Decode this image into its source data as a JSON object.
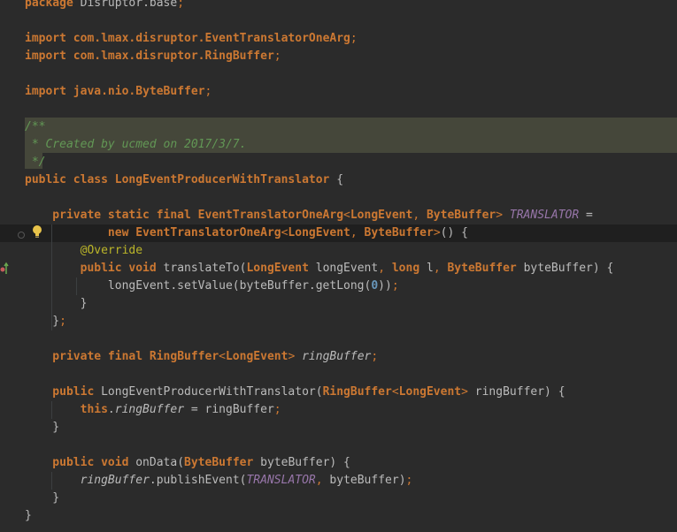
{
  "editor": {
    "lines": [
      {
        "tokens": [
          {
            "t": "package",
            "c": "kw"
          },
          {
            "t": " Disruptor.base",
            "c": "plain"
          },
          {
            "t": ";",
            "c": "punct"
          }
        ]
      },
      {
        "tokens": []
      },
      {
        "tokens": [
          {
            "t": "import",
            "c": "kw"
          },
          {
            "t": " com.lmax.disruptor.",
            "c": "type"
          },
          {
            "t": "EventTranslatorOneArg",
            "c": "type"
          },
          {
            "t": ";",
            "c": "punct"
          }
        ]
      },
      {
        "tokens": [
          {
            "t": "import",
            "c": "kw"
          },
          {
            "t": " com.lmax.disruptor.",
            "c": "type"
          },
          {
            "t": "RingBuffer",
            "c": "type"
          },
          {
            "t": ";",
            "c": "punct"
          }
        ]
      },
      {
        "tokens": []
      },
      {
        "tokens": [
          {
            "t": "import",
            "c": "kw"
          },
          {
            "t": " java.nio.",
            "c": "type"
          },
          {
            "t": "ByteBuffer",
            "c": "type"
          },
          {
            "t": ";",
            "c": "punct"
          }
        ]
      },
      {
        "tokens": []
      },
      {
        "tokens": [
          {
            "t": "/**",
            "c": "comment"
          }
        ]
      },
      {
        "tokens": [
          {
            "t": " * Created by ucmed on 2017/3/7.",
            "c": "comment"
          }
        ]
      },
      {
        "tokens": [
          {
            "t": " */",
            "c": "comment"
          }
        ]
      },
      {
        "tokens": [
          {
            "t": "public class",
            "c": "kw"
          },
          {
            "t": " LongEventProducerWithTranslator",
            "c": "type"
          },
          {
            "t": " {",
            "c": "plain"
          }
        ]
      },
      {
        "tokens": []
      },
      {
        "tokens": [
          {
            "t": "    private static final",
            "c": "kw"
          },
          {
            "t": " EventTranslatorOneArg",
            "c": "type"
          },
          {
            "t": "<",
            "c": "gen"
          },
          {
            "t": "LongEvent",
            "c": "type"
          },
          {
            "t": ", ",
            "c": "punct"
          },
          {
            "t": "ByteBuffer",
            "c": "type"
          },
          {
            "t": "> ",
            "c": "gen"
          },
          {
            "t": "TRANSLATOR",
            "c": "const"
          },
          {
            "t": " =",
            "c": "plain"
          }
        ]
      },
      {
        "tokens": [
          {
            "t": "            new",
            "c": "kw"
          },
          {
            "t": " EventTranslatorOneArg",
            "c": "type"
          },
          {
            "t": "<",
            "c": "gen"
          },
          {
            "t": "LongEvent",
            "c": "type"
          },
          {
            "t": ", ",
            "c": "punct"
          },
          {
            "t": "ByteBuffer",
            "c": "type"
          },
          {
            "t": ">",
            "c": "gen"
          },
          {
            "t": "() {",
            "c": "plain"
          }
        ]
      },
      {
        "tokens": [
          {
            "t": "        ",
            "c": "plain"
          },
          {
            "t": "@Override",
            "c": "ann"
          }
        ]
      },
      {
        "tokens": [
          {
            "t": "        public void",
            "c": "kw"
          },
          {
            "t": " translateTo(",
            "c": "plain"
          },
          {
            "t": "LongEvent",
            "c": "type"
          },
          {
            "t": " longEvent",
            "c": "plain"
          },
          {
            "t": ", ",
            "c": "punct"
          },
          {
            "t": "long",
            "c": "kw"
          },
          {
            "t": " l",
            "c": "plain"
          },
          {
            "t": ", ",
            "c": "punct"
          },
          {
            "t": "ByteBuffer",
            "c": "type"
          },
          {
            "t": " byteBuffer) {",
            "c": "plain"
          }
        ]
      },
      {
        "tokens": [
          {
            "t": "            longEvent.setValue(byteBuffer.getLong(",
            "c": "plain"
          },
          {
            "t": "0",
            "c": "num"
          },
          {
            "t": "))",
            "c": "plain"
          },
          {
            "t": ";",
            "c": "punct"
          }
        ]
      },
      {
        "tokens": [
          {
            "t": "        }",
            "c": "plain"
          }
        ]
      },
      {
        "tokens": [
          {
            "t": "    }",
            "c": "plain"
          },
          {
            "t": ";",
            "c": "punct"
          }
        ]
      },
      {
        "tokens": []
      },
      {
        "tokens": [
          {
            "t": "    private final",
            "c": "kw"
          },
          {
            "t": " RingBuffer",
            "c": "type"
          },
          {
            "t": "<",
            "c": "gen"
          },
          {
            "t": "LongEvent",
            "c": "type"
          },
          {
            "t": "> ",
            "c": "gen"
          },
          {
            "t": "ringBuffer",
            "c": "field"
          },
          {
            "t": ";",
            "c": "punct"
          }
        ]
      },
      {
        "tokens": []
      },
      {
        "tokens": [
          {
            "t": "    public",
            "c": "kw"
          },
          {
            "t": " LongEventProducerWithTranslator(",
            "c": "plain"
          },
          {
            "t": "RingBuffer",
            "c": "type"
          },
          {
            "t": "<",
            "c": "gen"
          },
          {
            "t": "LongEvent",
            "c": "type"
          },
          {
            "t": "> ",
            "c": "gen"
          },
          {
            "t": "ringBuffer) {",
            "c": "plain"
          }
        ]
      },
      {
        "tokens": [
          {
            "t": "        this",
            "c": "kw"
          },
          {
            "t": ".",
            "c": "plain"
          },
          {
            "t": "ringBuffer",
            "c": "field"
          },
          {
            "t": " = ringBuffer",
            "c": "plain"
          },
          {
            "t": ";",
            "c": "punct"
          }
        ]
      },
      {
        "tokens": [
          {
            "t": "    }",
            "c": "plain"
          }
        ]
      },
      {
        "tokens": []
      },
      {
        "tokens": [
          {
            "t": "    public void",
            "c": "kw"
          },
          {
            "t": " onData(",
            "c": "plain"
          },
          {
            "t": "ByteBuffer",
            "c": "type"
          },
          {
            "t": " byteBuffer) {",
            "c": "plain"
          }
        ]
      },
      {
        "tokens": [
          {
            "t": "        ",
            "c": "plain"
          },
          {
            "t": "ringBuffer",
            "c": "field"
          },
          {
            "t": ".publishEvent(",
            "c": "plain"
          },
          {
            "t": "TRANSLATOR",
            "c": "const"
          },
          {
            "t": ", ",
            "c": "punct"
          },
          {
            "t": "byteBuffer)",
            "c": "plain"
          },
          {
            "t": ";",
            "c": "punct"
          }
        ]
      },
      {
        "tokens": [
          {
            "t": "    }",
            "c": "plain"
          }
        ]
      },
      {
        "tokens": [
          {
            "t": "}",
            "c": "plain"
          }
        ]
      }
    ]
  },
  "icons": {
    "bulb": "lightbulb-icon",
    "override": "override-gutter-icon",
    "fold": "fold-marker-icon"
  },
  "colors": {
    "background": "#2b2b2b",
    "keyword": "#cc7832",
    "comment": "#629755",
    "annotation": "#bbb529",
    "constant": "#9876aa",
    "number": "#6897bb",
    "doc_highlight": "#45473a"
  }
}
